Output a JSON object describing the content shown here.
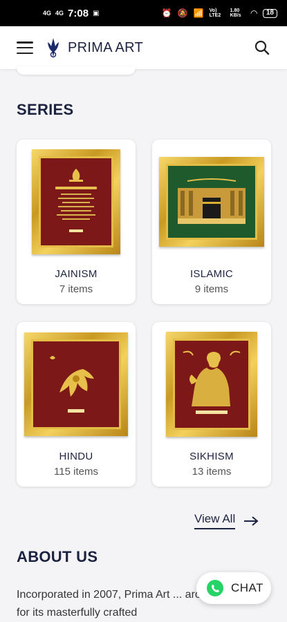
{
  "status_bar": {
    "network_1": "4G",
    "network_2": "4G",
    "time": "7:08",
    "network_info": "Vo) LTE2",
    "speed": "1.80 KB/s",
    "battery": "18"
  },
  "header": {
    "brand": "PRIMA ART"
  },
  "series": {
    "title": "SERIES",
    "cards": [
      {
        "name": "JAINISM",
        "count": "7 items"
      },
      {
        "name": "ISLAMIC",
        "count": "9 items"
      },
      {
        "name": "HINDU",
        "count": "115 items"
      },
      {
        "name": "SIKHISM",
        "count": "13 items"
      }
    ],
    "view_all": "View All"
  },
  "about": {
    "title": "ABOUT US",
    "text": "Incorporated in 2007, Prima Art ... around the world for its masterfully crafted"
  },
  "chat": {
    "label": "CHAT"
  },
  "colors": {
    "navy": "#1c2340",
    "gold": "#d9ae35",
    "maroon": "#8a1c1c",
    "green": "#1f5a2c",
    "whatsapp": "#25d366"
  }
}
